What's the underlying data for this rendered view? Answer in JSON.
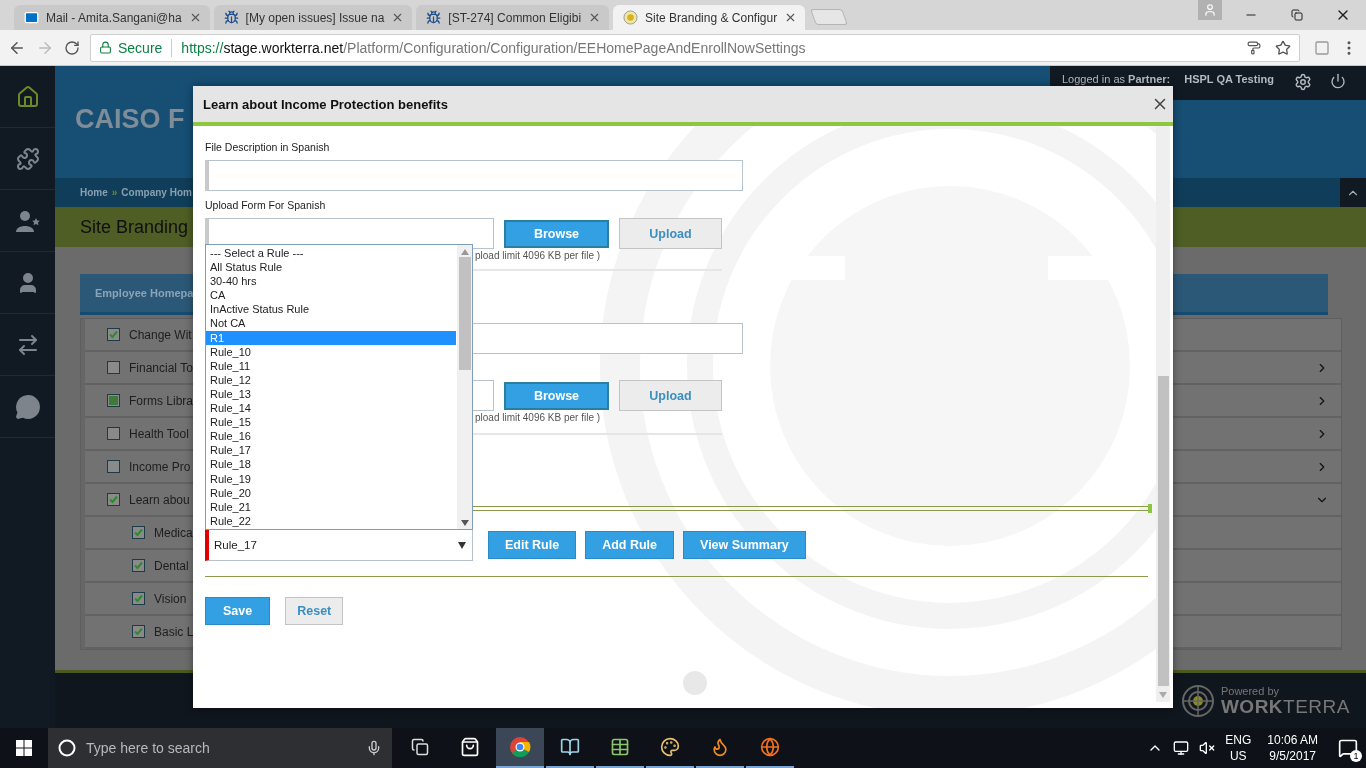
{
  "browser": {
    "tabs": [
      {
        "title": "Mail - Amita.Sangani@ha",
        "selected": false
      },
      {
        "title": "[My open issues] Issue na",
        "selected": false
      },
      {
        "title": "[ST-274] Common Eligibi",
        "selected": false
      },
      {
        "title": "Site Branding & Configur",
        "selected": true
      }
    ],
    "address": {
      "security": "Secure",
      "scheme": "https://",
      "host": "stage.workterra.net",
      "path": "/Platform/Configuration/Configuration/EEHomePageAndEnrollNowSettings"
    }
  },
  "header": {
    "title": "CAISO F",
    "login": "Logged in as **Partner:**",
    "user": "HSPL QA Testing"
  },
  "breadcrumb": {
    "items": [
      "Home",
      "Company Hom"
    ],
    "separator": "»"
  },
  "page_title": "Site Branding",
  "panel": {
    "title": "Employee Homepa",
    "rows": [
      {
        "label": "Change Wit",
        "checked": true,
        "indeterminate": false
      },
      {
        "label": "Financial To",
        "checked": false,
        "indeterminate": false,
        "expanded": false
      },
      {
        "label": "Forms Libra",
        "checked": false,
        "indeterminate": true,
        "expanded": false
      },
      {
        "label": "Health Tool",
        "checked": false,
        "indeterminate": false,
        "expanded": false
      },
      {
        "label": "Income Pro",
        "checked": false,
        "indeterminate": false,
        "expanded": false
      },
      {
        "label": "Learn abou",
        "checked": true,
        "indeterminate": false,
        "expanded": true,
        "children": [
          {
            "label": "Medica",
            "checked": true
          },
          {
            "label": "Dental",
            "checked": true
          },
          {
            "label": "Vision",
            "checked": true
          },
          {
            "label": "Basic L",
            "checked": true
          }
        ]
      }
    ]
  },
  "footer": {
    "powered_by": "Powered by",
    "brand": "**WORK**TERRA"
  },
  "modal": {
    "title": "Learn about Income Protection benefits",
    "sections": [
      {
        "kind": "text",
        "label": "File Description in Spanish"
      },
      {
        "kind": "upload",
        "label": "Upload Form For Spanish",
        "browse": "Browse",
        "upload": "Upload",
        "hint": "pload limit 4096 KB per file )"
      },
      {
        "kind": "text"
      },
      {
        "kind": "upload",
        "browse": "Browse",
        "upload": "Upload",
        "hint": "pload limit 4096 KB per file )"
      }
    ],
    "rule": {
      "value": "Rule_17",
      "invalid": true
    },
    "rule_buttons": [
      "Edit Rule",
      "Add Rule",
      "View Summary"
    ],
    "actions": [
      {
        "label": "Save",
        "kind": "primary"
      },
      {
        "label": "Reset",
        "kind": "secondary"
      }
    ],
    "dropdown": {
      "options": [
        {
          "label": "--- Select a Rule ---",
          "selected": false
        },
        {
          "label": "All Status Rule",
          "selected": false
        },
        {
          "label": "30-40 hrs",
          "selected": false
        },
        {
          "label": "CA",
          "selected": false
        },
        {
          "label": "InActive Status Rule",
          "selected": false
        },
        {
          "label": "Not CA",
          "selected": false
        },
        {
          "label": "R1",
          "selected": true
        },
        {
          "label": "Rule_10",
          "selected": false
        },
        {
          "label": "Rule_11",
          "selected": false
        },
        {
          "label": "Rule_12",
          "selected": false
        },
        {
          "label": "Rule_13",
          "selected": false
        },
        {
          "label": "Rule_14",
          "selected": false
        },
        {
          "label": "Rule_15",
          "selected": false
        },
        {
          "label": "Rule_16",
          "selected": false
        },
        {
          "label": "Rule_17",
          "selected": false
        },
        {
          "label": "Rule_18",
          "selected": false
        },
        {
          "label": "Rule_19",
          "selected": false
        },
        {
          "label": "Rule_20",
          "selected": false
        },
        {
          "label": "Rule_21",
          "selected": false
        },
        {
          "label": "Rule_22",
          "selected": false
        }
      ]
    }
  },
  "taskbar": {
    "search": {
      "placeholder": "Type here to search"
    },
    "apps": [
      {
        "running": false,
        "selected": false
      },
      {
        "running": true,
        "selected": true
      },
      {
        "running": true,
        "selected": false
      },
      {
        "running": true,
        "selected": false
      },
      {
        "running": true,
        "selected": false
      },
      {
        "running": true,
        "selected": false
      },
      {
        "running": true,
        "selected": false
      }
    ],
    "language": "ENG",
    "region": "US",
    "time": "10:06 AM",
    "date": "9/5/2017",
    "notifications": "1"
  }
}
